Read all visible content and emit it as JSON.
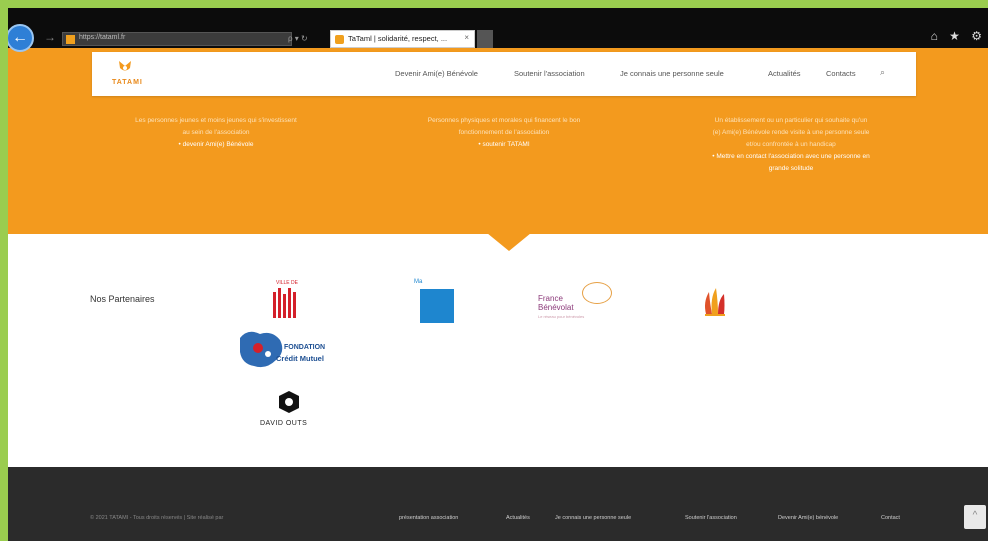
{
  "browser": {
    "address_text": "https://tataml.fr",
    "address_search_glyph": "ρ ▾ ↻",
    "tab_title": "TaTaml | solidarité, respect, ...",
    "tab_close": "×",
    "chrome_icons": "⌂ ★ ⚙",
    "back_glyph": "←",
    "forward_glyph": "→"
  },
  "navbar": {
    "logo_text": "TATAMI",
    "items": [
      "Devenir Ami(e) Bénévole",
      "Soutenir l'association",
      "Je connais une personne seule",
      "Actualités",
      "Contacts"
    ],
    "search_glyph": "⌕"
  },
  "hero": {
    "col1": {
      "line1": "Les personnes jeunes et moins jeunes qui s'investissent",
      "line2": "au sein de l'association",
      "link": "• devenir Ami(e) Bénévole"
    },
    "col2": {
      "line1": "Personnes physiques et morales qui financent le bon",
      "line2": "fonctionnement de l'association",
      "link": "• soutenir TATAMI"
    },
    "col3": {
      "line1": "Un établissement ou un particulier qui souhaite qu'un",
      "line2": "(e) Ami(e) Bénévole rende visite à une personne seule",
      "line3": "et/ou confrontée à un handicap",
      "link1": "• Mettre en contact l'association avec une personne en",
      "link2": "grande solitude"
    }
  },
  "partners": {
    "title": "Nos Partenaires",
    "lille_caption": "VILLE DE",
    "blue_caption": "Ma",
    "france_benevolat_1": "France",
    "france_benevolat_2": "Bénévolat",
    "france_benevolat_sub": "Le réseau pour bénévoles",
    "credit_line1": "FONDATION",
    "credit_line2": "Crédit Mutuel",
    "david_text": "DAVID OUTS"
  },
  "footer": {
    "copyright": "© 2021 TATAMI - Tous droits réservés | Site réalisé par",
    "links": [
      "présentation association",
      "Actualités",
      "Je connais une personne seule",
      "Soutenir l'association",
      "Devenir Ami(e) bénévole",
      "Contact"
    ],
    "scroll_top_glyph": "^"
  },
  "colors": {
    "hero": "#f39a1e",
    "footer": "#2b2b2b",
    "frame": "#9acd4f"
  }
}
